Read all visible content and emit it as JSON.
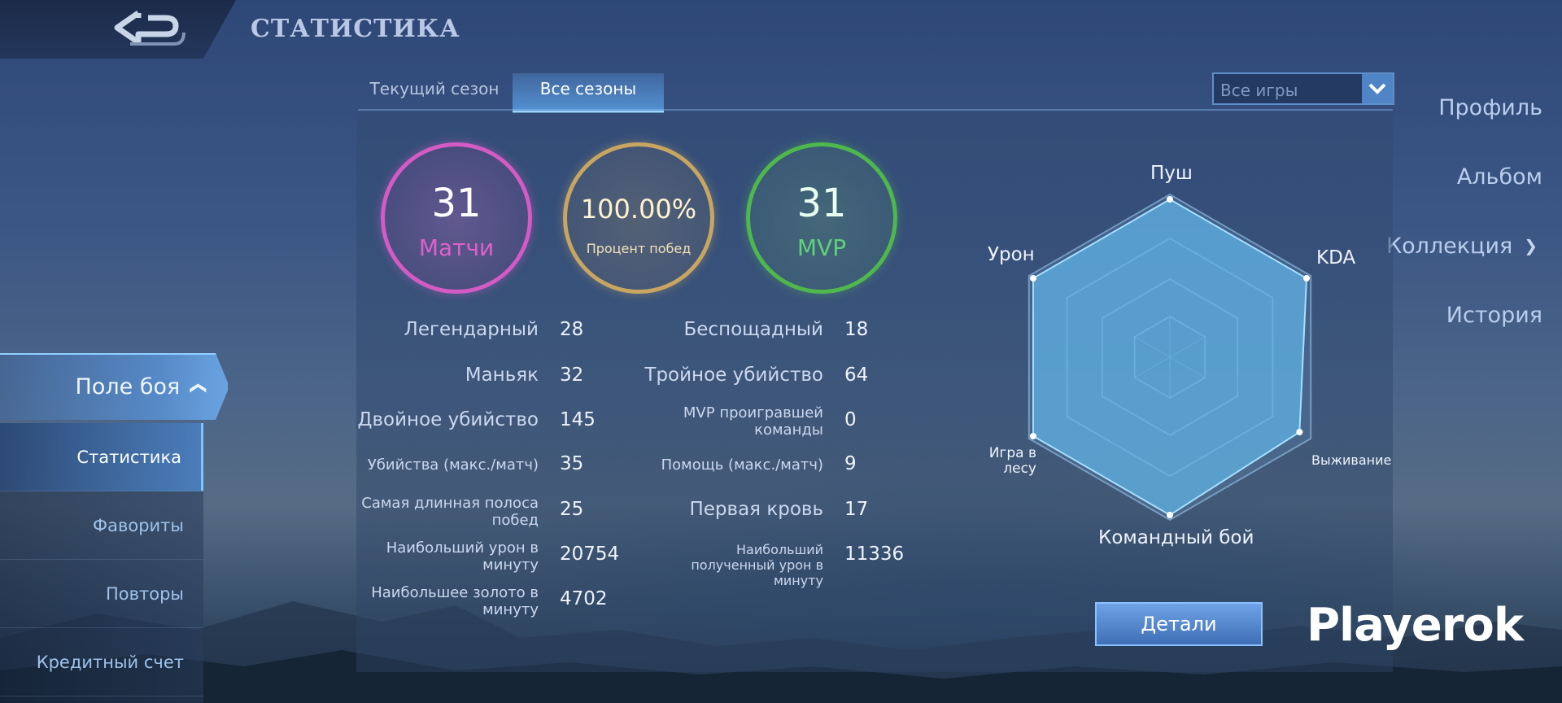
{
  "header": {
    "title": "СТАТИСТИКА"
  },
  "sidebar": {
    "items": [
      {
        "label": "Профиль"
      },
      {
        "label": "Альбом"
      },
      {
        "label": "Коллекция"
      },
      {
        "label": "История"
      },
      {
        "label": "Поле боя"
      }
    ],
    "sub_items": [
      {
        "label": "Статистика"
      },
      {
        "label": "Фавориты"
      },
      {
        "label": "Повторы"
      },
      {
        "label": "Кредитный счет"
      }
    ]
  },
  "tabs": [
    {
      "label": "Текущий сезон"
    },
    {
      "label": "Все сезоны"
    }
  ],
  "filter": {
    "value": "Все игры"
  },
  "summary": {
    "matches": {
      "value": "31",
      "label": "Матчи"
    },
    "winrate": {
      "value": "100.00%",
      "label": "Процент побед"
    },
    "mvp": {
      "value": "31",
      "label": "MVP"
    }
  },
  "stats_left": [
    {
      "label": "Легендарный",
      "value": "28"
    },
    {
      "label": "Маньяк",
      "value": "32"
    },
    {
      "label": "Двойное убийство",
      "value": "145"
    },
    {
      "label": "Убийства (макс./матч)",
      "value": "35"
    },
    {
      "label": "Самая длинная полоса побед",
      "value": "25"
    },
    {
      "label": "Наибольший урон в минуту",
      "value": "20754"
    },
    {
      "label": "Наибольшее золото в минуту",
      "value": "4702"
    }
  ],
  "stats_right": [
    {
      "label": "Беспощадный",
      "value": "18"
    },
    {
      "label": "Тройное убийство",
      "value": "64"
    },
    {
      "label": "MVP проигравшей команды",
      "value": "0"
    },
    {
      "label": "Помощь (макс./матч)",
      "value": "9"
    },
    {
      "label": "Первая кровь",
      "value": "17"
    },
    {
      "label": "Наибольший полученный урон в минуту",
      "value": "11336"
    }
  ],
  "radar": {
    "axes": [
      "Пуш",
      "KDA",
      "Выживание",
      "Командный бой",
      "Игра в лесу",
      "Урон"
    ],
    "values": [
      0.97,
      0.97,
      0.92,
      0.97,
      0.97,
      0.97
    ],
    "fill_color": "#5fb4e6"
  },
  "buttons": {
    "details": "Детали"
  },
  "watermark": "Playerok"
}
